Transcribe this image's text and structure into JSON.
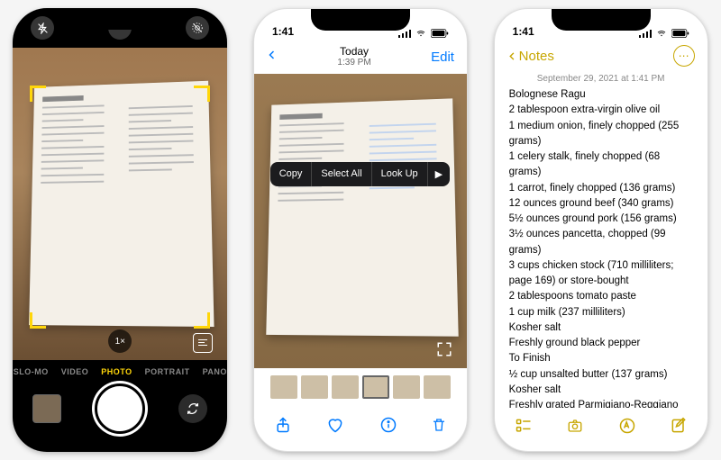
{
  "camera": {
    "modes": [
      "SLO-MO",
      "VIDEO",
      "PHOTO",
      "PORTRAIT",
      "PANO"
    ],
    "selected_mode": "PHOTO",
    "zoom": "1×"
  },
  "photos": {
    "time": "1:41",
    "nav_title": "Today",
    "nav_sub": "1:39 PM",
    "edit": "Edit",
    "menu": {
      "copy": "Copy",
      "selectall": "Select All",
      "lookup": "Look Up"
    }
  },
  "notes": {
    "time": "1:41",
    "back_label": "Notes",
    "date": "September 29, 2021 at 1:41 PM",
    "lines": [
      "Bolognese Ragu",
      "2 tablespoon extra-virgin olive oil",
      "1 medium onion, finely chopped (255 grams)",
      "1 celery stalk, finely chopped (68 grams)",
      "1 carrot, finely chopped (136 grams)",
      "12 ounces ground beef (340 grams)",
      "5½ ounces ground pork (156 grams)",
      "3½ ounces pancetta, chopped (99 grams)",
      "3 cups chicken stock (710 milliliters; page 169) or store-bought",
      "2 tablespoons tomato paste",
      "1 cup milk (237 milliliters)",
      "Kosher salt",
      "Freshly ground black pepper",
      "To Finish",
      "½ cup unsalted butter (137 grams)",
      "Kosher salt",
      "Freshly grated Parmigiano-Reggiano cheese, for finishing"
    ]
  }
}
